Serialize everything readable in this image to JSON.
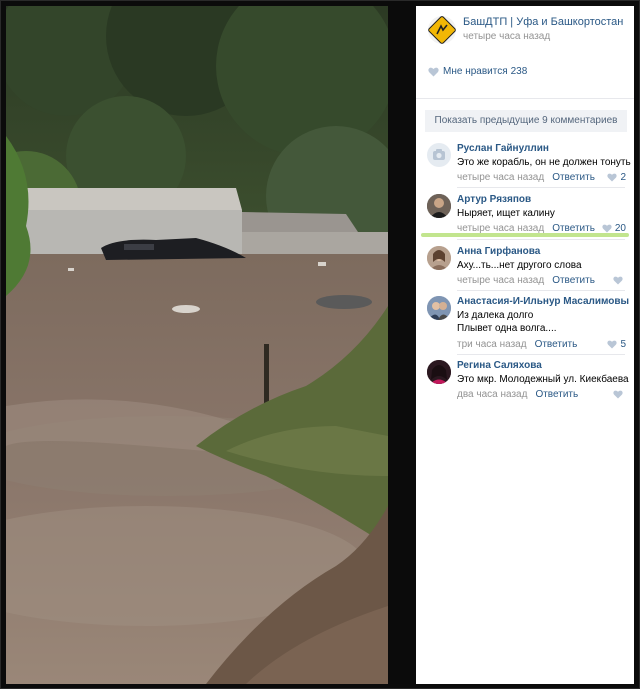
{
  "post": {
    "group_name": "БашДТП | Уфа и Башкортостан",
    "time": "четыре часа назад",
    "like_label": "Мне нравится",
    "like_count": "238",
    "show_previous": "Показать предыдущие 9 комментариев"
  },
  "comments": [
    {
      "author": "Руслан Гайнуллин",
      "text": [
        "Это же корабль, он не должен тонуть"
      ],
      "time": "четыре часа назад",
      "reply": "Ответить",
      "likes": "2",
      "avatar": "camera-placeholder"
    },
    {
      "author": "Артур Рязяпов",
      "text": [
        "Ныряет, ищет калину"
      ],
      "time": "четыре часа назад",
      "reply": "Ответить",
      "likes": "20",
      "avatar": "photo"
    },
    {
      "author": "Анна Гирфанова",
      "text": [
        "Аху...ть...нет другого слова"
      ],
      "time": "четыре часа назад",
      "reply": "Ответить",
      "likes": "",
      "avatar": "photo"
    },
    {
      "author": "Анастасия-И-Ильнур Масалимовы",
      "text": [
        "Из далека долго",
        "Плывет одна волга...."
      ],
      "time": "три часа назад",
      "reply": "Ответить",
      "likes": "5",
      "avatar": "photo"
    },
    {
      "author": "Регина Саляхова",
      "text": [
        "Это мкр. Молодежный ул. Киекбаева"
      ],
      "time": "два часа назад",
      "reply": "Ответить",
      "likes": "",
      "avatar": "photo"
    }
  ],
  "colors": {
    "link": "#2a5885",
    "meta": "#939393",
    "highlight": "#b7e07a"
  },
  "photo": {
    "icon": "flood-photo"
  }
}
